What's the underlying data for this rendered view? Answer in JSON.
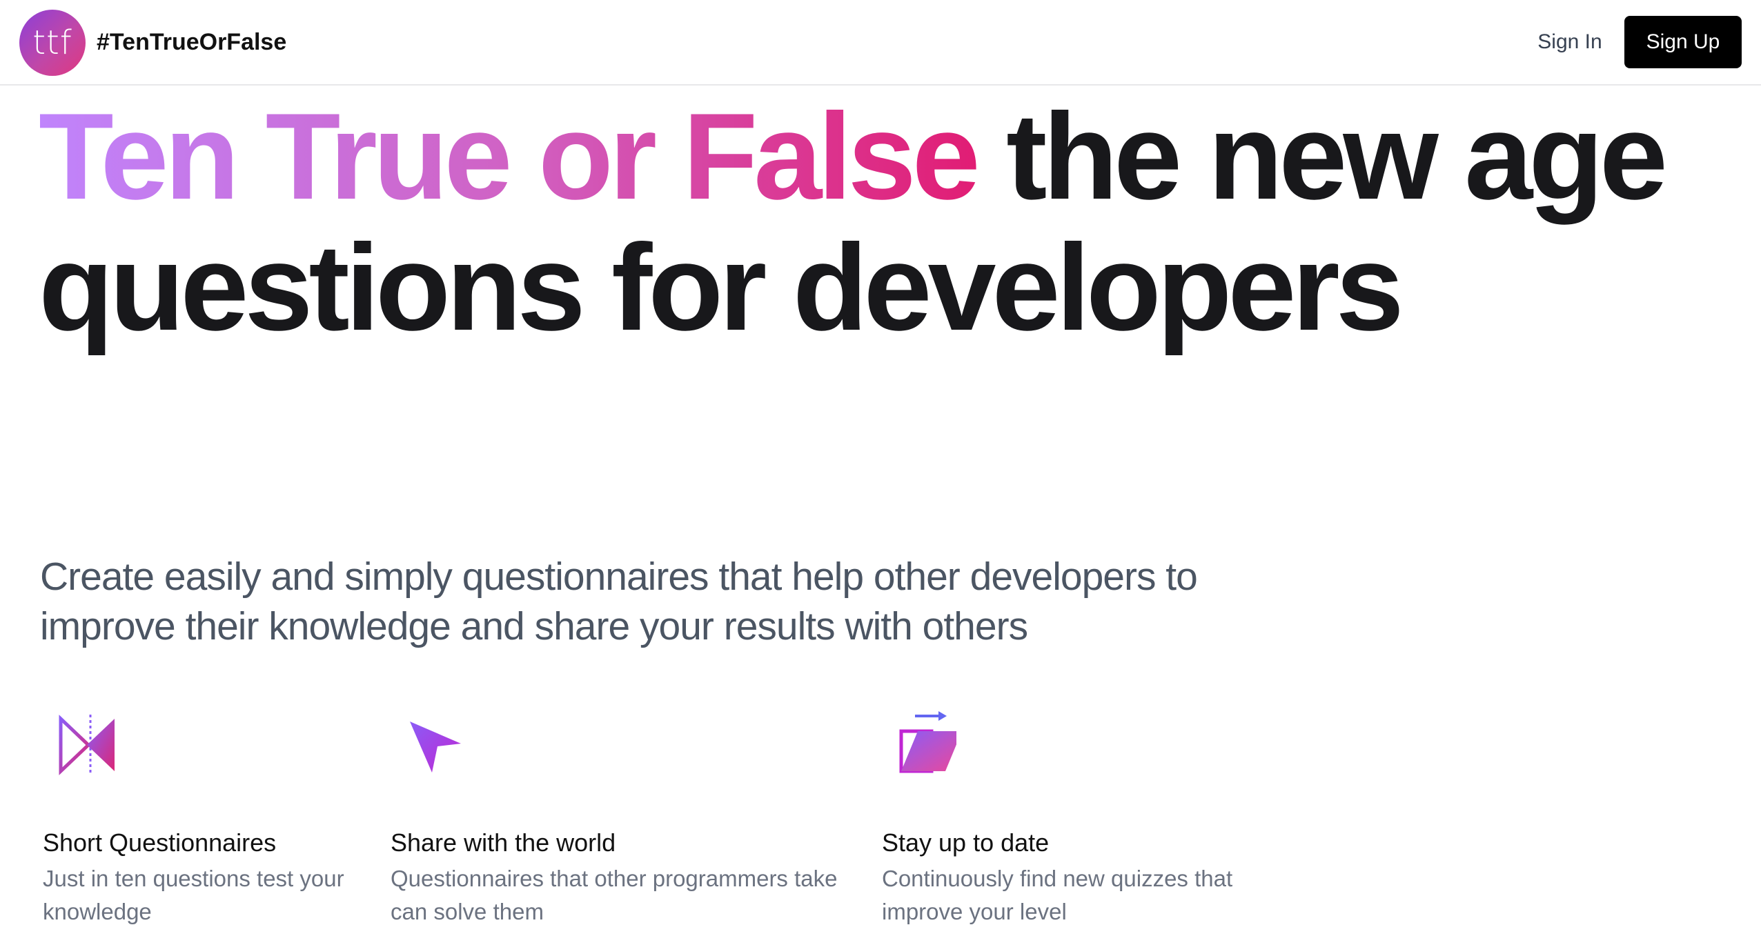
{
  "header": {
    "logo_text": "ttf",
    "brand": "#TenTrueOrFalse",
    "sign_in": "Sign In",
    "sign_up": "Sign Up"
  },
  "hero": {
    "title_highlight": "Ten True or False",
    "title_rest": " the new age questions for developers",
    "subtitle": "Create easily and simply questionnaires that help other developers to improve their knowledge and share your results with others"
  },
  "features": [
    {
      "icon": "mirror-triangles-icon",
      "title": "Short Questionnaires",
      "description": "Just in ten questions test your knowledge"
    },
    {
      "icon": "cursor-arrow-icon",
      "title": "Share with the world",
      "description": "Questionnaires that other programmers take can solve them"
    },
    {
      "icon": "export-folder-icon",
      "title": "Stay up to date",
      "description": "Continuously find new quizzes that improve your level"
    }
  ],
  "colors": {
    "gradient_start": "#c084fc",
    "gradient_end": "#e11d74",
    "primary_button": "#000000"
  }
}
